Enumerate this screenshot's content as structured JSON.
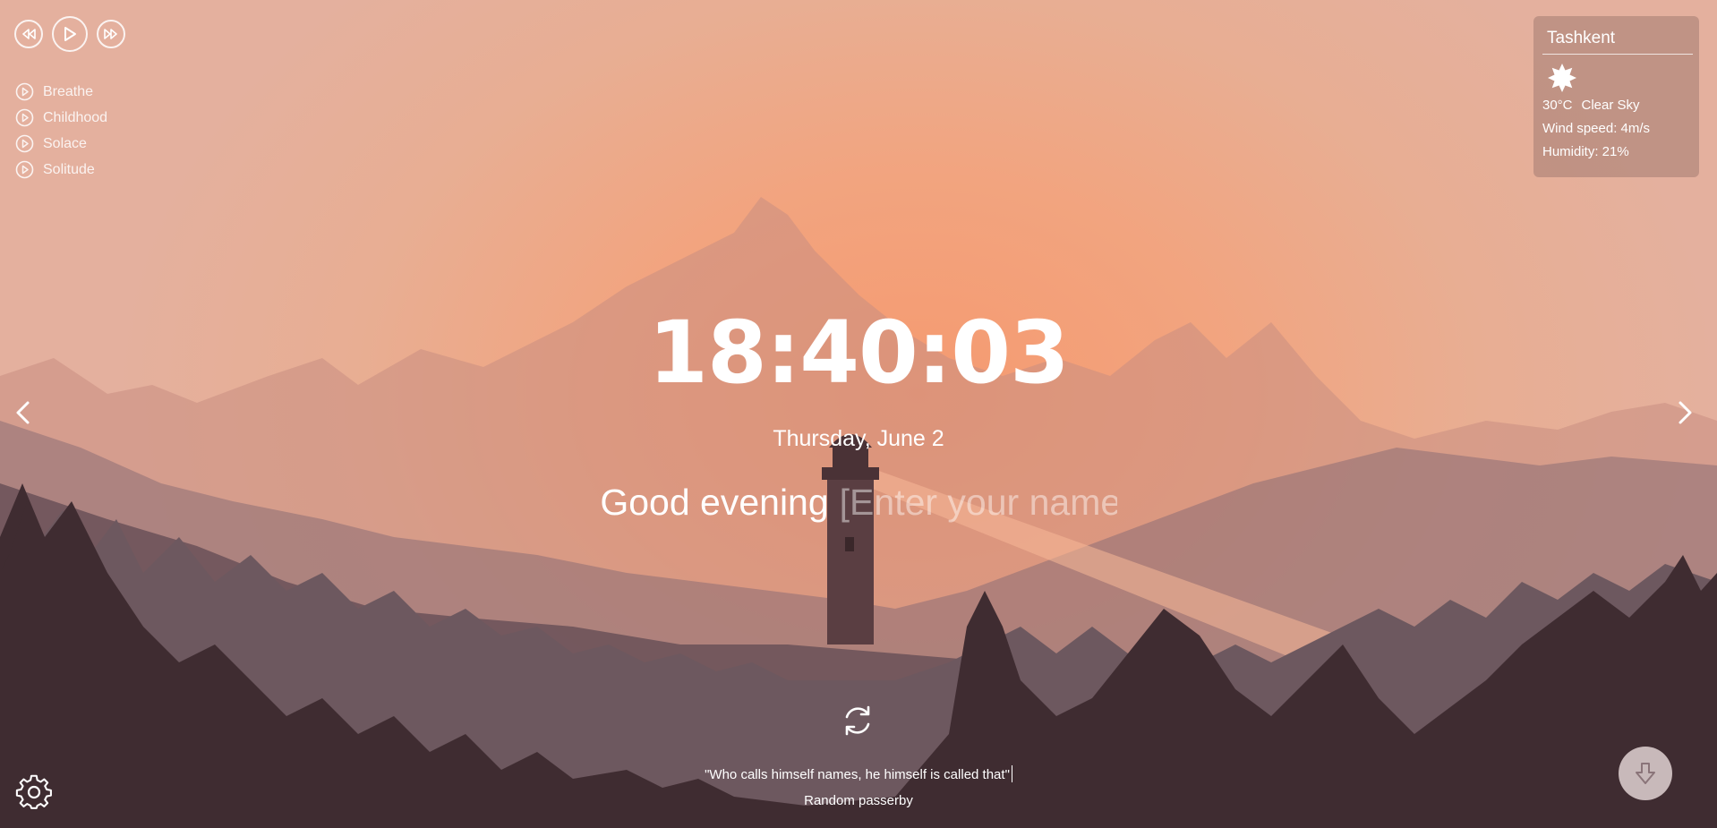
{
  "player": {
    "prev_icon": "rewind-icon",
    "play_icon": "play-icon",
    "next_icon": "fast-forward-icon",
    "tracks": [
      {
        "label": "Breathe"
      },
      {
        "label": "Childhood"
      },
      {
        "label": "Solace"
      },
      {
        "label": "Solitude"
      }
    ]
  },
  "weather": {
    "city": "Tashkent",
    "icon": "sun-icon",
    "temperature": "30°C",
    "description": "Clear Sky",
    "wind": "Wind speed: 4m/s",
    "humidity": "Humidity: 21%"
  },
  "clock": {
    "time": "18:40:03",
    "date": "Thursday, June 2"
  },
  "greeting": {
    "text": "Good evening",
    "name_placeholder": "[Enter your name]"
  },
  "quote": {
    "text": "\"Who calls himself names, he himself is called that\"",
    "author": "Random passerby"
  },
  "controls": {
    "slider_prev_icon": "chevron-left-icon",
    "slider_next_icon": "chevron-right-icon",
    "refresh_icon": "refresh-icon",
    "settings_icon": "gear-icon",
    "download_icon": "download-arrow-icon"
  },
  "colors": {
    "sky_center": "#f59a70",
    "sky_edge": "#e4b09e",
    "tree_dark": "#3d2b30"
  }
}
